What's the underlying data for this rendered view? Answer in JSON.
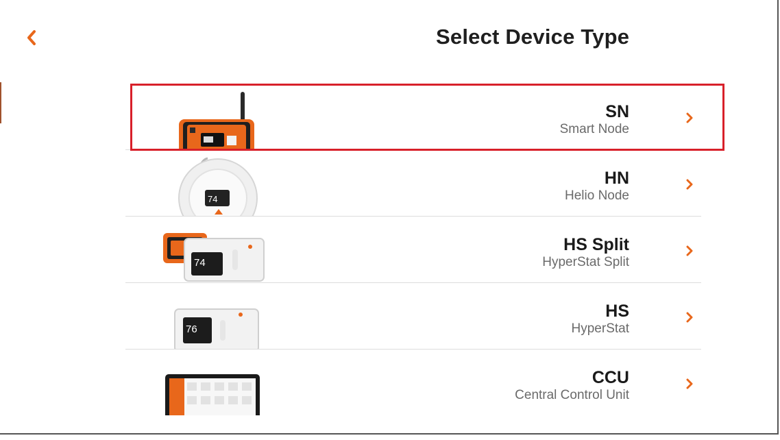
{
  "header": {
    "title": "Select Device Type",
    "back_icon": "chevron-left-icon"
  },
  "devices": [
    {
      "code": "SN",
      "name": "Smart Node",
      "icon": "smart-node-image"
    },
    {
      "code": "HN",
      "name": "Helio Node",
      "icon": "helio-node-image"
    },
    {
      "code": "HS Split",
      "name": "HyperStat Split",
      "icon": "hyperstat-split-image"
    },
    {
      "code": "HS",
      "name": "HyperStat",
      "icon": "hyperstat-image"
    },
    {
      "code": "CCU",
      "name": "Central Control Unit",
      "icon": "ccu-tablet-image"
    }
  ],
  "thumb_text": {
    "hn_display": "74",
    "hs_split_display": "74",
    "hs_display": "76"
  },
  "colors": {
    "accent": "#e8671b",
    "highlight": "#d8202a",
    "title": "#1f1f1f",
    "subtitle": "#6a6a6a"
  }
}
